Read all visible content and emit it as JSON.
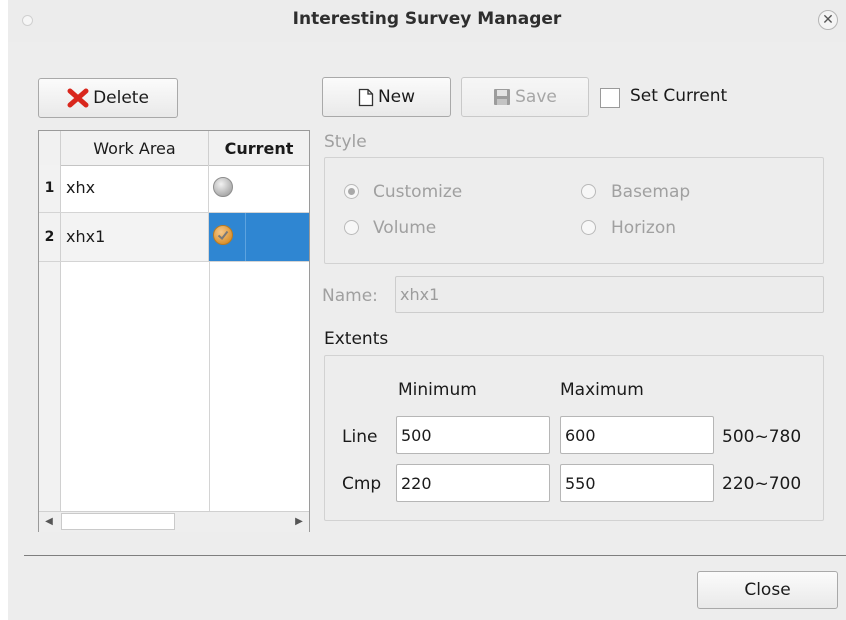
{
  "window": {
    "title": "Interesting Survey Manager"
  },
  "toolbar": {
    "delete_label": "Delete",
    "new_label": "New",
    "save_label": "Save",
    "set_current_label": "Set Current",
    "set_current_checked": false
  },
  "table": {
    "headers": [
      "Work Area",
      "Current"
    ],
    "rows": [
      {
        "num": "1",
        "work_area": "xhx",
        "current": false
      },
      {
        "num": "2",
        "work_area": "xhx1",
        "current": true
      }
    ]
  },
  "style": {
    "label": "Style",
    "options": [
      "Customize",
      "Basemap",
      "Volume",
      "Horizon"
    ],
    "selected": "Customize"
  },
  "name": {
    "label": "Name:",
    "value": "xhx1"
  },
  "extents": {
    "label": "Extents",
    "min_header": "Minimum",
    "max_header": "Maximum",
    "rows": [
      {
        "label": "Line",
        "min": "500",
        "max": "600",
        "range": "500~780"
      },
      {
        "label": "Cmp",
        "min": "220",
        "max": "550",
        "range": "220~700"
      }
    ]
  },
  "footer": {
    "close_label": "Close"
  },
  "colors": {
    "selection": "#2f86d2",
    "delete_icon": "#d9261c"
  }
}
